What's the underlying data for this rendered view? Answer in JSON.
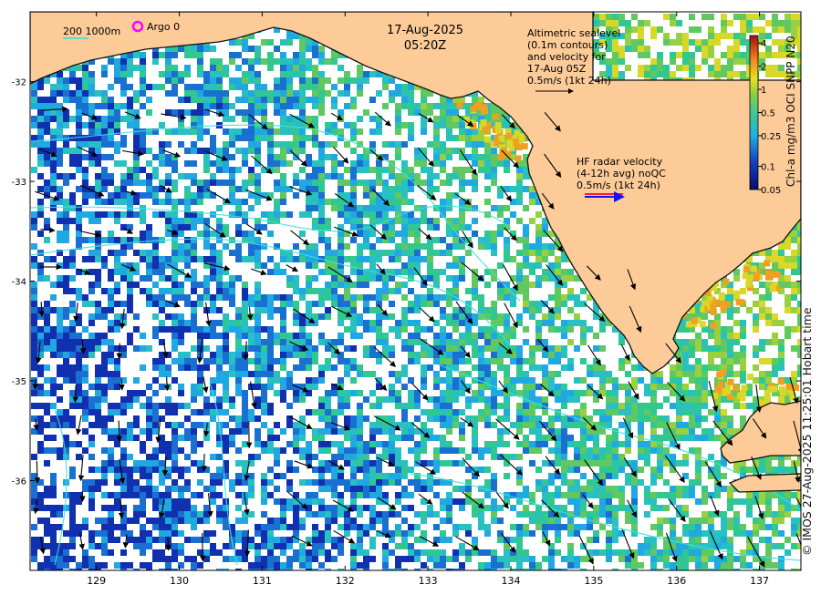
{
  "map": {
    "date": "17-Aug-2025",
    "time": "05:20Z",
    "x_ticks": [
      "129",
      "130",
      "131",
      "132",
      "133",
      "134",
      "135",
      "136",
      "137"
    ],
    "y_ticks": [
      "-32",
      "-33",
      "-34",
      "-35",
      "-36"
    ],
    "x_range": [
      128.2,
      137.5
    ],
    "y_range": [
      -36.9,
      -31.3
    ],
    "land_color": "#fccb98",
    "ocean_nodata_color": "#ffffff"
  },
  "legend": {
    "bathy_label": "200  1000m",
    "argo_label": "Argo 0",
    "argo_color": "#ff00ff",
    "altimetry_text": [
      "Altimetric sealevel",
      "(0.1m contours)",
      "and velocity for",
      "17-Aug 05Z",
      "0.5m/s (1kt 24h)"
    ],
    "hf_text": [
      "HF radar velocity",
      "(4-12h avg) noQC",
      "0.5m/s (1kt 24h)"
    ]
  },
  "colorbar": {
    "title": "Chl-a mg/m3 OCI SNPP N20",
    "ticks": [
      "4",
      "2",
      "1",
      "0.5",
      "0.25",
      "0.1",
      "0.05"
    ],
    "tick_values": [
      4,
      2,
      1,
      0.5,
      0.25,
      0.1,
      0.05
    ],
    "range": [
      0.05,
      5
    ],
    "scale": "log"
  },
  "credit": "© IMOS 27-Aug-2025 11:25:01 Hobart time"
}
